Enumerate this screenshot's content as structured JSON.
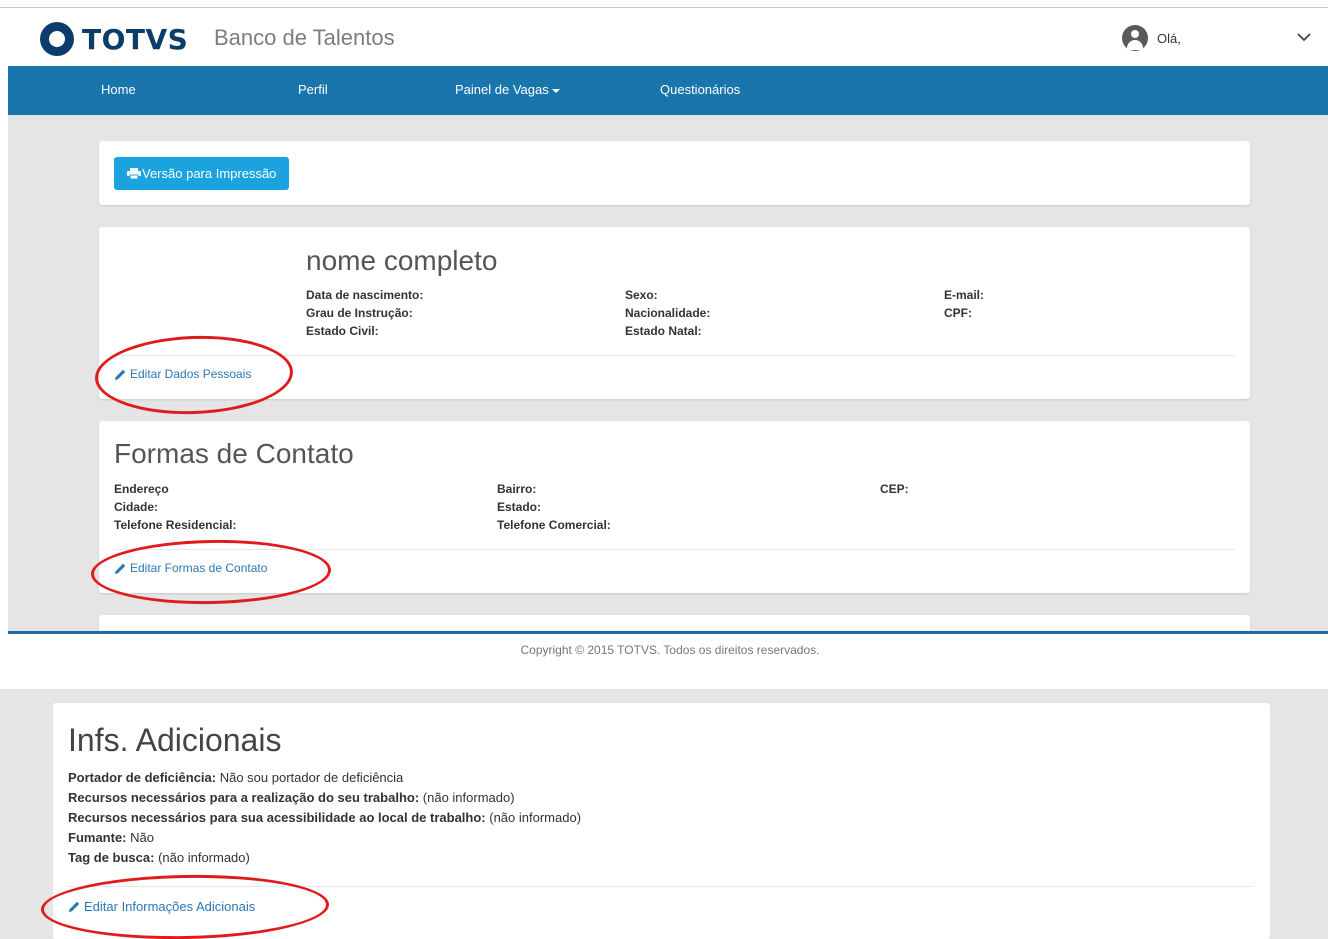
{
  "header": {
    "logo_text": "TOTVS",
    "app_title": "Banco de Talentos",
    "greeting": "Olá,"
  },
  "nav": {
    "items": [
      "Home",
      "Perfil",
      "Painel de Vagas",
      "Questionários"
    ]
  },
  "toolbar": {
    "print_label": "Versão para Impressão"
  },
  "personal": {
    "name": "nome completo",
    "fields": {
      "birth": "Data de nascimento:",
      "education": "Grau de Instrução:",
      "marital": "Estado Civil:",
      "sex": "Sexo:",
      "nationality": "Nacionalidade:",
      "natal_state": "Estado Natal:",
      "email": "E-mail:",
      "cpf": "CPF:"
    },
    "edit_label": "Editar Dados Pessoais"
  },
  "contact": {
    "title": "Formas de Contato",
    "fields": {
      "address": "Endereço",
      "city": "Cidade:",
      "home_phone": "Telefone Residencial:",
      "district": "Bairro:",
      "state": "Estado:",
      "work_phone": "Telefone Comercial:",
      "zip": "CEP:"
    },
    "edit_label": "Editar Formas de Contato"
  },
  "footer": {
    "copyright": "Copyright © 2015 TOTVS. Todos os direitos reservados."
  },
  "additional": {
    "title": "Infs. Adicionais",
    "rows": [
      {
        "label": "Portador de deficiência:",
        "value": "Não sou portador de deficiência"
      },
      {
        "label": "Recursos necessários para a realização do seu trabalho:",
        "value": "(não informado)"
      },
      {
        "label": "Recursos necessários para sua acessibilidade ao local de trabalho:",
        "value": "(não informado)"
      },
      {
        "label": "Fumante:",
        "value": "Não"
      },
      {
        "label": "Tag de busca:",
        "value": "(não informado)"
      }
    ],
    "edit_label": "Editar Informações Adicionais"
  },
  "colors": {
    "navbar": "#1a75ad",
    "button": "#1aa3de",
    "link": "#2a78b5",
    "annotation": "#e01b1b",
    "brand": "#0b3d6b"
  }
}
